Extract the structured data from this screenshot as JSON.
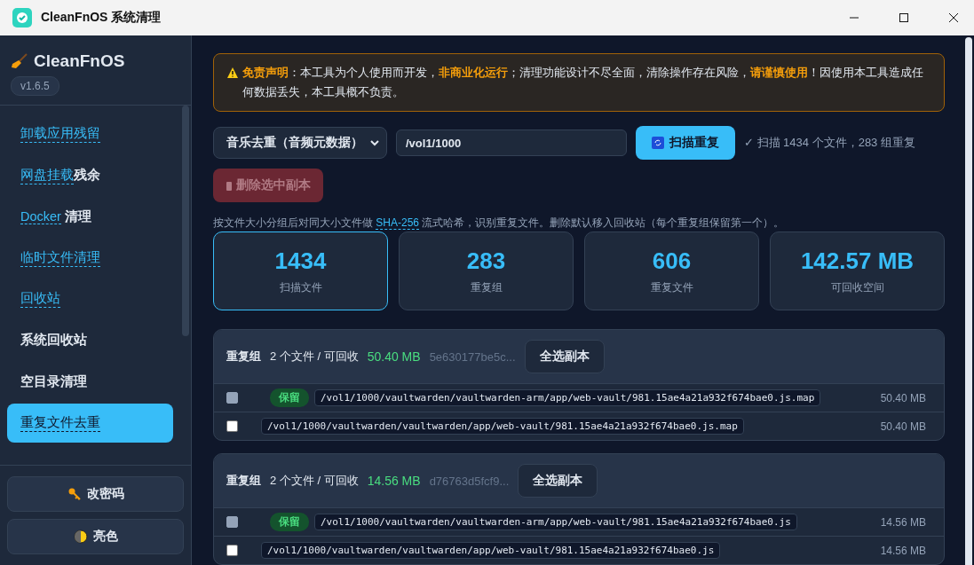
{
  "window": {
    "title": "CleanFnOS 系统清理"
  },
  "sidebar": {
    "brand": "CleanFnOS",
    "version": "v1.6.5",
    "items": [
      {
        "linked": "卸载应用残留",
        "selected": false
      },
      {
        "linked": "网盘挂载",
        "text": "残余",
        "selected": false
      },
      {
        "linked": "Docker",
        "text": " 清理",
        "selected": false
      },
      {
        "linked": "临时文件清理",
        "selected": false
      },
      {
        "linked": "回收站",
        "selected": false
      },
      {
        "text": "系统回收站",
        "selected": false
      },
      {
        "text": "空目录清理",
        "selected": false
      },
      {
        "linked": "重复文件去重",
        "selected": true
      }
    ],
    "buttons": [
      {
        "kind": "key",
        "label": "改密码"
      },
      {
        "kind": "theme",
        "label": "亮色"
      }
    ]
  },
  "disclaimer": "**免责声明**：本工具为个人使用而开发，**非商业化运行**；清理功能设计不尽全面，清除操作存在风险，**请谨慎使用**！因使用本工具造成任何数据丢失，本工具概不负责。",
  "toolbar": {
    "mode": "音乐去重（音频元数据）",
    "path": "/vol1/1000",
    "scan_button": "扫描重复",
    "status": "✓ 扫描 1434 个文件，283 组重复",
    "delete_button": {
      "label": "删除选中副本",
      "disabled": true
    }
  },
  "hint": {
    "before": "按文件大小分组后对同大小文件做 ",
    "term": "SHA-256",
    "after": " 流式哈希，识别重复文件。删除默认移入回收站（每个重复组保留第一个）。"
  },
  "stats": [
    {
      "value": "1434",
      "label": "扫描文件",
      "selected": true
    },
    {
      "value": "283",
      "label": "重复组",
      "selected": false
    },
    {
      "value": "606",
      "label": "重复文件",
      "selected": false
    },
    {
      "value": "142.57 MB",
      "label": "可回收空间",
      "selected": false
    }
  ],
  "groups": [
    {
      "title": "重复组",
      "count": "2 个文件 / 可回收",
      "size": "50.40 MB",
      "hash": "5e630177be5c...",
      "select_button": "全选副本",
      "files": [
        {
          "keep": true,
          "badge": "保留",
          "checked": false,
          "disabled": true,
          "path": "/vol1/1000/vaultwarden/vaultwarden-arm/app/web-vault/981.15ae4a21a932f674bae0.js.map",
          "size": "50.40 MB"
        },
        {
          "keep": false,
          "checked": false,
          "disabled": false,
          "path": "/vol1/1000/vaultwarden/vaultwarden/app/web-vault/981.15ae4a21a932f674bae0.js.map",
          "size": "50.40 MB"
        }
      ]
    },
    {
      "title": "重复组",
      "count": "2 个文件 / 可回收",
      "size": "14.56 MB",
      "hash": "d76763d5fcf9...",
      "select_button": "全选副本",
      "files": [
        {
          "keep": true,
          "badge": "保留",
          "checked": false,
          "disabled": true,
          "path": "/vol1/1000/vaultwarden/vaultwarden-arm/app/web-vault/981.15ae4a21a932f674bae0.js",
          "size": "14.56 MB"
        },
        {
          "keep": false,
          "checked": false,
          "disabled": false,
          "path": "/vol1/1000/vaultwarden/vaultwarden/app/web-vault/981.15ae4a21a932f674bae0.js",
          "size": "14.56 MB"
        }
      ]
    }
  ]
}
